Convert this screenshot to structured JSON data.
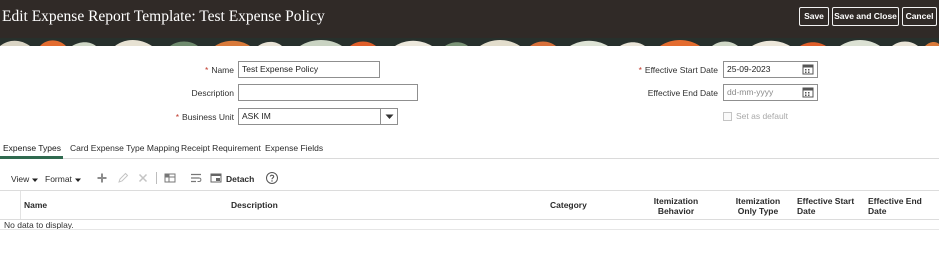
{
  "header": {
    "title": "Edit Expense Report Template: Test Expense Policy",
    "save_label": "Save",
    "save_close_label": "Save and Close",
    "cancel_label": "Cancel"
  },
  "form": {
    "name_label": "Name",
    "name_value": "Test Expense Policy",
    "description_label": "Description",
    "description_value": "",
    "business_unit_label": "Business Unit",
    "business_unit_value": "ASK IM",
    "effective_start_label": "Effective Start Date",
    "effective_start_value": "25-09-2023",
    "effective_end_label": "Effective End Date",
    "effective_end_placeholder": "dd-mm-yyyy",
    "set_default_label": "Set as default",
    "set_default_checked": false,
    "required_marker": "*"
  },
  "tabs": [
    {
      "label": "Expense Types",
      "active": true
    },
    {
      "label": "Card Expense Type Mapping",
      "active": false
    },
    {
      "label": "Receipt Requirement",
      "active": false
    },
    {
      "label": "Expense Fields",
      "active": false
    }
  ],
  "toolbar": {
    "view_label": "View",
    "format_label": "Format",
    "detach_label": "Detach",
    "icons": [
      "add-icon",
      "edit-icon",
      "delete-icon",
      "freeze-icon",
      "wrap-icon",
      "detach-icon",
      "help-icon"
    ]
  },
  "table": {
    "columns": [
      {
        "line1": "Name",
        "line2": ""
      },
      {
        "line1": "Description",
        "line2": ""
      },
      {
        "line1": "Category",
        "line2": ""
      },
      {
        "line1": "Itemization",
        "line2": "Behavior"
      },
      {
        "line1": "Itemization",
        "line2": "Only Type"
      },
      {
        "line1": "Effective Start",
        "line2": "Date"
      },
      {
        "line1": "Effective End",
        "line2": "Date"
      }
    ],
    "rows": [],
    "empty_text": "No data to display."
  },
  "colors": {
    "header_bg": "#302a27",
    "accent_green": "#2f6a4f",
    "required": "#c0392b"
  }
}
